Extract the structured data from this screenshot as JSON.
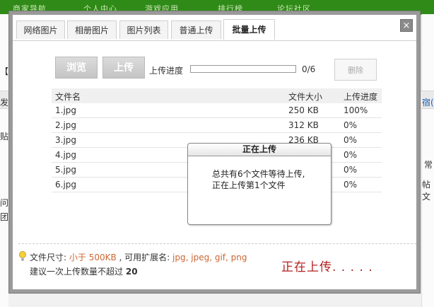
{
  "background": {
    "nav": [
      "商家导航",
      "个人中心",
      "游戏应用",
      "排行榜",
      "论坛社区"
    ],
    "fragments": [
      "【右",
      "发布",
      "贴图",
      "问题",
      "团",
      "宿(",
      "常",
      "帖文"
    ]
  },
  "dialog": {
    "tabs": [
      {
        "label": "网络图片",
        "active": false
      },
      {
        "label": "相册图片",
        "active": false
      },
      {
        "label": "图片列表",
        "active": false
      },
      {
        "label": "普通上传",
        "active": false
      },
      {
        "label": "批量上传",
        "active": true
      }
    ],
    "close_label": "×",
    "toolbar": {
      "browse_label": "浏览",
      "upload_label": "上传",
      "progress_label": "上传进度",
      "progress_count": "0/6",
      "progress_fraction": 0,
      "delete_label": "删除"
    },
    "table": {
      "headers": {
        "name": "文件名",
        "size": "文件大小",
        "progress": "上传进度"
      },
      "rows": [
        {
          "name": "1.jpg",
          "size": "250 KB",
          "progress": "100%"
        },
        {
          "name": "2.jpg",
          "size": "312 KB",
          "progress": "0%"
        },
        {
          "name": "3.jpg",
          "size": "236 KB",
          "progress": "0%"
        },
        {
          "name": "4.jpg",
          "size": "",
          "progress": "0%"
        },
        {
          "name": "5.jpg",
          "size": "",
          "progress": "0%"
        },
        {
          "name": "6.jpg",
          "size": "",
          "progress": "0%"
        }
      ]
    },
    "popup": {
      "title": "正在上传",
      "line1": "总共有6个文件等待上传,",
      "line2": "正在上传第1个文件"
    },
    "hint": {
      "label": "文件尺寸:",
      "size_limit": "小于 500KB",
      "ext_label": ", 可用扩展名:",
      "extensions": "jpg, jpeg, gif, png",
      "count_text": "建议一次上传数量不超过",
      "count_value": "20"
    },
    "status": "正在上传. . . . ."
  },
  "colors": {
    "accent_hint": "#cc6633",
    "status_red": "#b32020"
  }
}
